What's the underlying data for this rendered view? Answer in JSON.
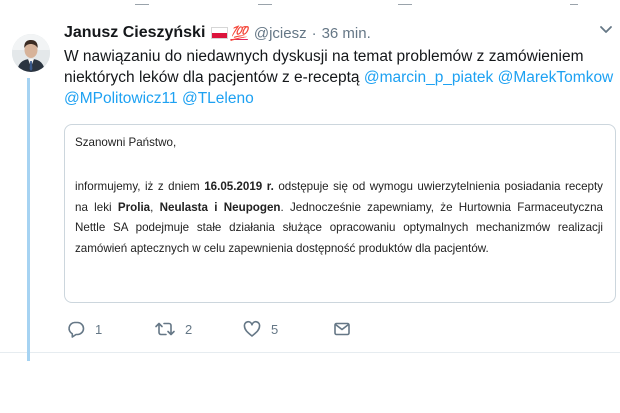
{
  "tweet": {
    "author_name": "Janusz Cieszyński",
    "emoji_hundred": "💯",
    "handle": "@jciesz",
    "separator": "·",
    "time": "36 min.",
    "text_intro": "W nawiązaniu do niedawnych dyskusji na temat problemów z zamówieniem niektórych leków dla pacjentów z e-receptą",
    "mentions": [
      "@marcin_p_piatek",
      "@MarekTomkow",
      "@MPolitowicz11",
      "@TLeleno"
    ],
    "letter": {
      "greeting": "Szanowni Państwo,",
      "p1": "informujemy, iż z dniem",
      "date": "16.05.2019 r.",
      "p2": "odstępuje się od wymogu uwierzytelnienia posiadania recepty na leki",
      "drug1": "Prolia",
      "comma": ",",
      "drug2": "Neulasta",
      "and": "i",
      "drug3": "Neupogen",
      "p3": ". Jednocześnie zapewniamy, że Hurtownia Farmaceutyczna Nettle SA podejmuje stałe działania służące opracowaniu optymalnych mechanizmów realizacji zamówień aptecznych w celu zapewnienia dostępność produktów dla pacjentów."
    },
    "actions": {
      "reply_count": "1",
      "retweet_count": "2",
      "like_count": "5"
    }
  },
  "icons": [
    "avatar",
    "poland-flag-icon",
    "hundred-points-icon",
    "chevron-down-icon",
    "reply-icon",
    "retweet-icon",
    "like-icon",
    "direct-message-icon"
  ],
  "colors": {
    "accent": "#1da1f2",
    "thread_line": "#a6d3f2",
    "secondary_text": "#657786",
    "border": "#ccd6dd"
  }
}
